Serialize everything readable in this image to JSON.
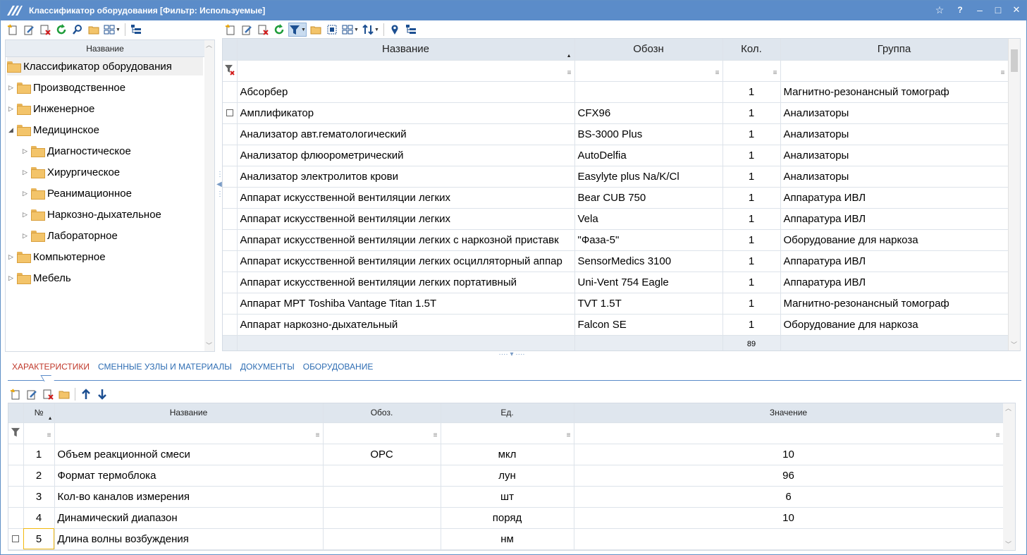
{
  "window": {
    "title": "Классификатор оборудования [Фильтр: Используемые]",
    "buttons": {
      "star": "☆",
      "help": "?",
      "minimize": "–",
      "maximize": "□",
      "close": "✕"
    }
  },
  "tree": {
    "header": "Название",
    "nodes": [
      {
        "label": "Классификатор оборудования",
        "level": 0,
        "expander": "",
        "selected": true
      },
      {
        "label": "Производственное",
        "level": 1,
        "expander": "▷"
      },
      {
        "label": "Инженерное",
        "level": 1,
        "expander": "▷"
      },
      {
        "label": "Медицинское",
        "level": 1,
        "expander": "◢"
      },
      {
        "label": "Диагностическое",
        "level": 2,
        "expander": "▷"
      },
      {
        "label": "Хирургическое",
        "level": 2,
        "expander": "▷"
      },
      {
        "label": "Реанимационное",
        "level": 2,
        "expander": "▷"
      },
      {
        "label": "Наркозно-дыхательное",
        "level": 2,
        "expander": "▷"
      },
      {
        "label": "Лабораторное",
        "level": 2,
        "expander": "▷"
      },
      {
        "label": "Компьютерное",
        "level": 1,
        "expander": "▷"
      },
      {
        "label": "Мебель",
        "level": 1,
        "expander": "▷"
      }
    ]
  },
  "grid": {
    "columns": [
      "Название",
      "Обозн",
      "Кол.",
      "Группа"
    ],
    "sort_marker": "▲",
    "filter_marker": "≡",
    "rows": [
      {
        "name": "Абсорбер",
        "code": "",
        "qty": "1",
        "group": "Магнитно-резонансный томограф"
      },
      {
        "name": "Амплификатор",
        "code": "CFX96",
        "qty": "1",
        "group": "Анализаторы"
      },
      {
        "name": "Анализатор авт.гематологический",
        "code": "BS-3000 Plus",
        "qty": "1",
        "group": "Анализаторы"
      },
      {
        "name": "Анализатор флюорометрический",
        "code": "AutoDelfia",
        "qty": "1",
        "group": "Анализаторы"
      },
      {
        "name": "Анализатор электролитов крови",
        "code": "Easylyte plus Na/K/Cl",
        "qty": "1",
        "group": "Анализаторы"
      },
      {
        "name": "Аппарат искусственной вентиляции легких",
        "code": "Bear CUB 750",
        "qty": "1",
        "group": "Аппаратура ИВЛ"
      },
      {
        "name": "Аппарат искусственной вентиляции легких",
        "code": "Vela",
        "qty": "1",
        "group": "Аппаратура ИВЛ"
      },
      {
        "name": "Аппарат искусственной вентиляции легких  с наркозной приставк",
        "code": "\"Фаза-5\"",
        "qty": "1",
        "group": "Оборудование для наркоза"
      },
      {
        "name": "Аппарат искусственной вентиляции легких осцилляторный аппар",
        "code": "SensorMedics 3100",
        "qty": "1",
        "group": "Аппаратура ИВЛ"
      },
      {
        "name": "Аппарат искусственной вентиляции легких портативный",
        "code": "Uni-Vent 754 Eagle",
        "qty": "1",
        "group": "Аппаратура ИВЛ"
      },
      {
        "name": "Аппарат МРТ Toshiba Vantage Titan 1.5T",
        "code": "TVT 1.5T",
        "qty": "1",
        "group": "Магнитно-резонансный томограф"
      },
      {
        "name": "Аппарат наркозно-дыхательный",
        "code": "Falcon SE",
        "qty": "1",
        "group": "Оборудование для наркоза"
      }
    ],
    "footer_count": "89"
  },
  "tabs": [
    "ХАРАКТЕРИСТИКИ",
    "СМЕННЫЕ УЗЛЫ И МАТЕРИАЛЫ",
    "ДОКУМЕНТЫ",
    "ОБОРУДОВАНИЕ"
  ],
  "chars": {
    "columns": [
      "№",
      "Название",
      "Обоз.",
      "Ед.",
      "Значение"
    ],
    "rows": [
      {
        "num": "1",
        "name": "Объем реакционной смеси",
        "code": "ОРС",
        "unit": "мкл",
        "value": "10"
      },
      {
        "num": "2",
        "name": "Формат термоблока",
        "code": "",
        "unit": "лун",
        "value": "96"
      },
      {
        "num": "3",
        "name": "Кол-во каналов измерения",
        "code": "",
        "unit": "шт",
        "value": "6"
      },
      {
        "num": "4",
        "name": "Динамический диапазон",
        "code": "",
        "unit": "поряд",
        "value": "10"
      },
      {
        "num": "5",
        "name": "Длина волны возбуждения",
        "code": "",
        "unit": "нм",
        "value": ""
      }
    ]
  },
  "colors": {
    "titlebar": "#5b8cc9",
    "header": "#dfe6ee",
    "active_tab": "#c0392b",
    "link": "#2e6db3",
    "focus": "#f2b90f"
  }
}
